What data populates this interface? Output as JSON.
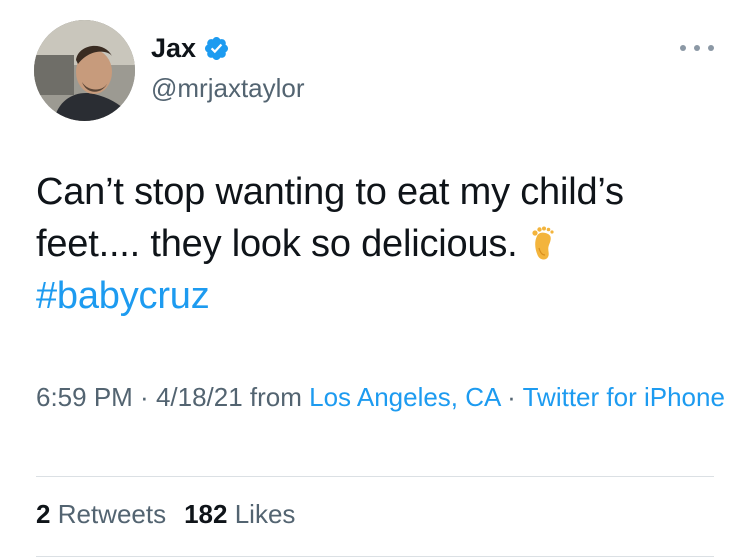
{
  "author": {
    "display_name": "Jax",
    "handle": "@mrjaxtaylor",
    "verified": true,
    "avatar_icon": "profile-photo"
  },
  "tweet": {
    "line1": "Can’t stop wanting to eat my child’s",
    "line2": "feet.... they look so delicious.",
    "emoji": "foot",
    "hashtag": "#babycruz"
  },
  "meta": {
    "time": "6:59 PM",
    "sep1": " · ",
    "date": "4/18/21",
    "from_label": " from ",
    "location": "Los Angeles, CA",
    "sep2": " · ",
    "client": "Twitter for iPhone"
  },
  "stats": {
    "retweets_count": "2",
    "retweets_label": "Retweets",
    "likes_count": "182",
    "likes_label": "Likes"
  },
  "colors": {
    "link": "#1d9bf0",
    "secondary_text": "#536471",
    "primary_text": "#0f1419",
    "verified_badge": "#1d9bf0"
  }
}
